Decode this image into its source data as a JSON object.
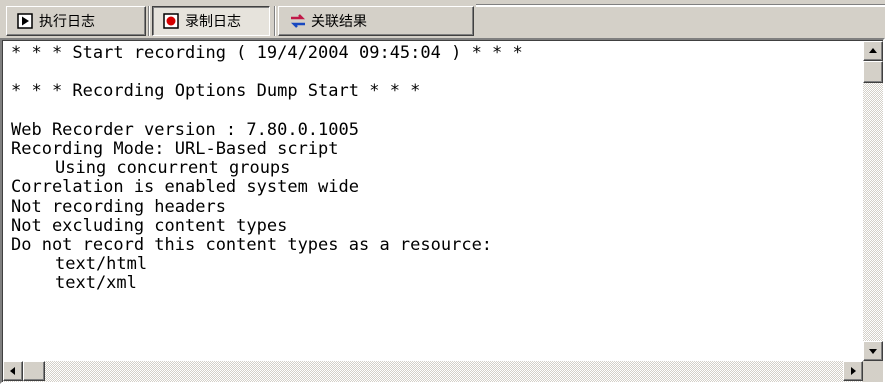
{
  "tabs": [
    {
      "label": "执行日志",
      "icon": "play-log-icon",
      "selected": false
    },
    {
      "label": "录制日志",
      "icon": "record-log-icon",
      "selected": true
    },
    {
      "label": "关联结果",
      "icon": "correlation-icon",
      "selected": false
    }
  ],
  "log": {
    "lines": [
      {
        "text": "* * * Start recording ( 19/4/2004 09:45:04 ) * * *",
        "indent": false
      },
      {
        "text": "",
        "indent": false
      },
      {
        "text": "* * * Recording Options Dump Start * * *",
        "indent": false
      },
      {
        "text": "",
        "indent": false
      },
      {
        "text": "Web Recorder version : 7.80.0.1005",
        "indent": false
      },
      {
        "text": "Recording Mode: URL-Based script",
        "indent": false
      },
      {
        "text": "Using concurrent groups",
        "indent": true
      },
      {
        "text": "Correlation is enabled system wide",
        "indent": false
      },
      {
        "text": "Not recording headers",
        "indent": false
      },
      {
        "text": "Not excluding content types",
        "indent": false
      },
      {
        "text": "Do not record this content types as a resource:",
        "indent": false
      },
      {
        "text": "text/html",
        "indent": true
      },
      {
        "text": "text/xml",
        "indent": true
      }
    ]
  },
  "colors": {
    "record_icon": "#d40000",
    "correlation_icon_a": "#c01848",
    "correlation_icon_b": "#1848c0"
  }
}
